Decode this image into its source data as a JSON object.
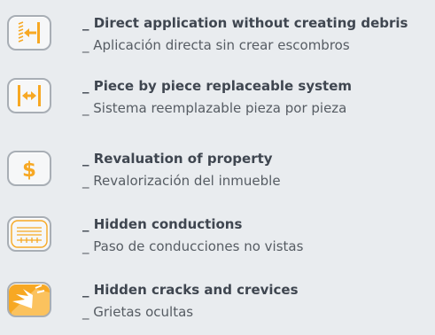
{
  "accent_color": "#f7a823",
  "features": [
    {
      "icon": "wall-arrow-icon",
      "title": "_ Direct application without creating debris",
      "subtitle": "_  Aplicación directa sin crear escombros"
    },
    {
      "icon": "replace-arrows-icon",
      "title": "_ Piece by piece replaceable system",
      "subtitle": "_  Sistema reemplazable pieza por pieza"
    },
    {
      "icon": "dollar-icon",
      "title": "_ Revaluation of property",
      "subtitle": "_  Revalorización del inmueble"
    },
    {
      "icon": "conduits-icon",
      "title": "_ Hidden conductions",
      "subtitle": "_  Paso de conducciones no vistas"
    },
    {
      "icon": "crack-icon",
      "title": "_ Hidden cracks and crevices",
      "subtitle": "_  Grietas ocultas"
    }
  ]
}
